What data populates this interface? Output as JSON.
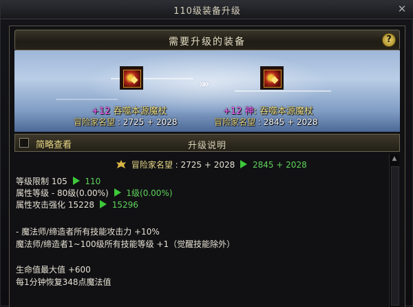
{
  "window": {
    "title": "110级装备升级"
  },
  "header": {
    "title": "需要升级的装备",
    "help": "?"
  },
  "items": {
    "source": {
      "plus": "+12",
      "name": "吞噬本源魔杖",
      "reputation_label": "冒险家名望",
      "reputation": "2725 + 2028"
    },
    "arrow": "»»",
    "target": {
      "plus": "+12",
      "prefix": "神",
      "name": "吞噬本源魔杖",
      "reputation_label": "冒险家名望",
      "reputation": "2845 + 2028"
    }
  },
  "subbar": {
    "brief_label": "简略查看",
    "explain_title": "升级说明"
  },
  "explain": {
    "reputation_label": "冒险家名望",
    "reputation_from": "2725 + 2028",
    "reputation_to": "2845 + 2028",
    "level_label": "等级限制",
    "level_from": "105",
    "level_to": "110",
    "element_label": "属性等级",
    "element_from": "- 80级(0.00%)",
    "element_to": "1级(0.00%)",
    "enhance_label": "属性攻击强化",
    "enhance_from": "15228",
    "enhance_to": "15296",
    "effect1": "- 魔法师/缔造者所有技能攻击力 +10%",
    "effect2": "魔法师/缔造者1~100级所有技能等级 +1（觉醒技能除外）",
    "effect3": "生命值最大值 +600",
    "effect4": "每1分钟恢复348点魔法值"
  },
  "icons": {
    "close": "close-icon",
    "help": "help-icon",
    "scroll_up": "scroll-up-icon",
    "reputation": "reputation-crest-icon"
  },
  "colors": {
    "accent_gold": "#e8d886",
    "upgrade_green": "#5fd35a",
    "plus_magenta": "#ff62ff"
  }
}
